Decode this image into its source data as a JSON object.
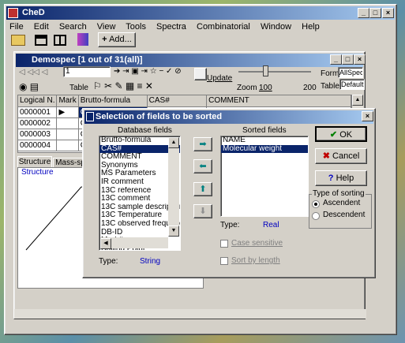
{
  "app": {
    "title": "CheD",
    "menu": [
      "File",
      "Edit",
      "Search",
      "View",
      "Tools",
      "Spectra",
      "Combinatorial",
      "Window",
      "Help"
    ],
    "toolbar_add": "Add..."
  },
  "child": {
    "title": "Demospec [1 out of 31(all)]",
    "record_field": "1",
    "table_label": "Table",
    "update_label": "Update",
    "zoom_label": "Zoom",
    "zoom_value": "100",
    "zoom_max": "200",
    "form_label": "Form",
    "form_value": "AllSpec",
    "table_sel_label": "Table",
    "table_sel_value": "Default",
    "columns": [
      "Logical N.",
      "Mark",
      "Brutto-formula",
      "CAS#",
      "COMMENT"
    ],
    "rows": [
      {
        "id": "0000001",
        "mark": "▶",
        "formula": "C5"
      },
      {
        "id": "0000002",
        "mark": "",
        "formula": "C1"
      },
      {
        "id": "0000003",
        "mark": "",
        "formula": "CS"
      },
      {
        "id": "0000004",
        "mark": "",
        "formula": "C1"
      }
    ],
    "tabs": [
      "Structure",
      "Mass-sp"
    ],
    "structure_caption": "Structure",
    "atom_label": "O"
  },
  "dialog": {
    "title": "Selection of fields to be sorted",
    "db_fields_label": "Database fields",
    "sorted_fields_label": "Sorted fields",
    "db_fields": [
      "Brutto-formula",
      "CAS#",
      "COMMENT",
      "Synonyms",
      "MS Parameters",
      "IR comment",
      "13C reference",
      "13C comment",
      "13C sample description",
      "13C Temperature",
      "13C observed frequency",
      "DB-ID",
      "Merk#",
      "Boiling Point",
      "Melting Point"
    ],
    "db_selected_index": 1,
    "sorted_fields": [
      "NAME",
      "Molecular weight"
    ],
    "sorted_selected_index": 1,
    "type_label": "Type:",
    "type_left": "String",
    "type_right": "Real",
    "case_sensitive": "Case sensitive",
    "sort_by_length": "Sort by length",
    "ok": "OK",
    "cancel": "Cancel",
    "help": "Help",
    "sorting_group": "Type of sorting",
    "ascendent": "Ascendent",
    "descendent": "Descendent"
  }
}
